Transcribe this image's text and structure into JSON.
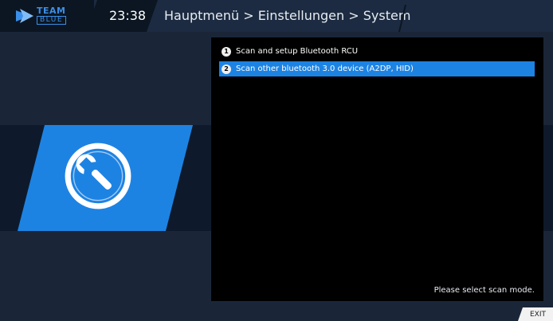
{
  "logo": {
    "line1": "TEAM",
    "line2": "BLUE"
  },
  "header": {
    "time": "23:38",
    "breadcrumb": "Hauptmenü > Einstellungen > System"
  },
  "menu": {
    "items": [
      {
        "number": "1",
        "label": "Scan and setup Bluetooth RCU",
        "selected": false
      },
      {
        "number": "2",
        "label": "Scan other bluetooth 3.0 device (A2DP, HID)",
        "selected": true
      }
    ]
  },
  "status": "Please select scan mode.",
  "footer": {
    "exit_label": "EXIT"
  },
  "icons": {
    "logo": "team-blue-logo-icon",
    "section": "wrench-settings-icon"
  },
  "colors": {
    "accent": "#1d83e3",
    "background": "#1a2638",
    "list_bg": "#000000"
  }
}
